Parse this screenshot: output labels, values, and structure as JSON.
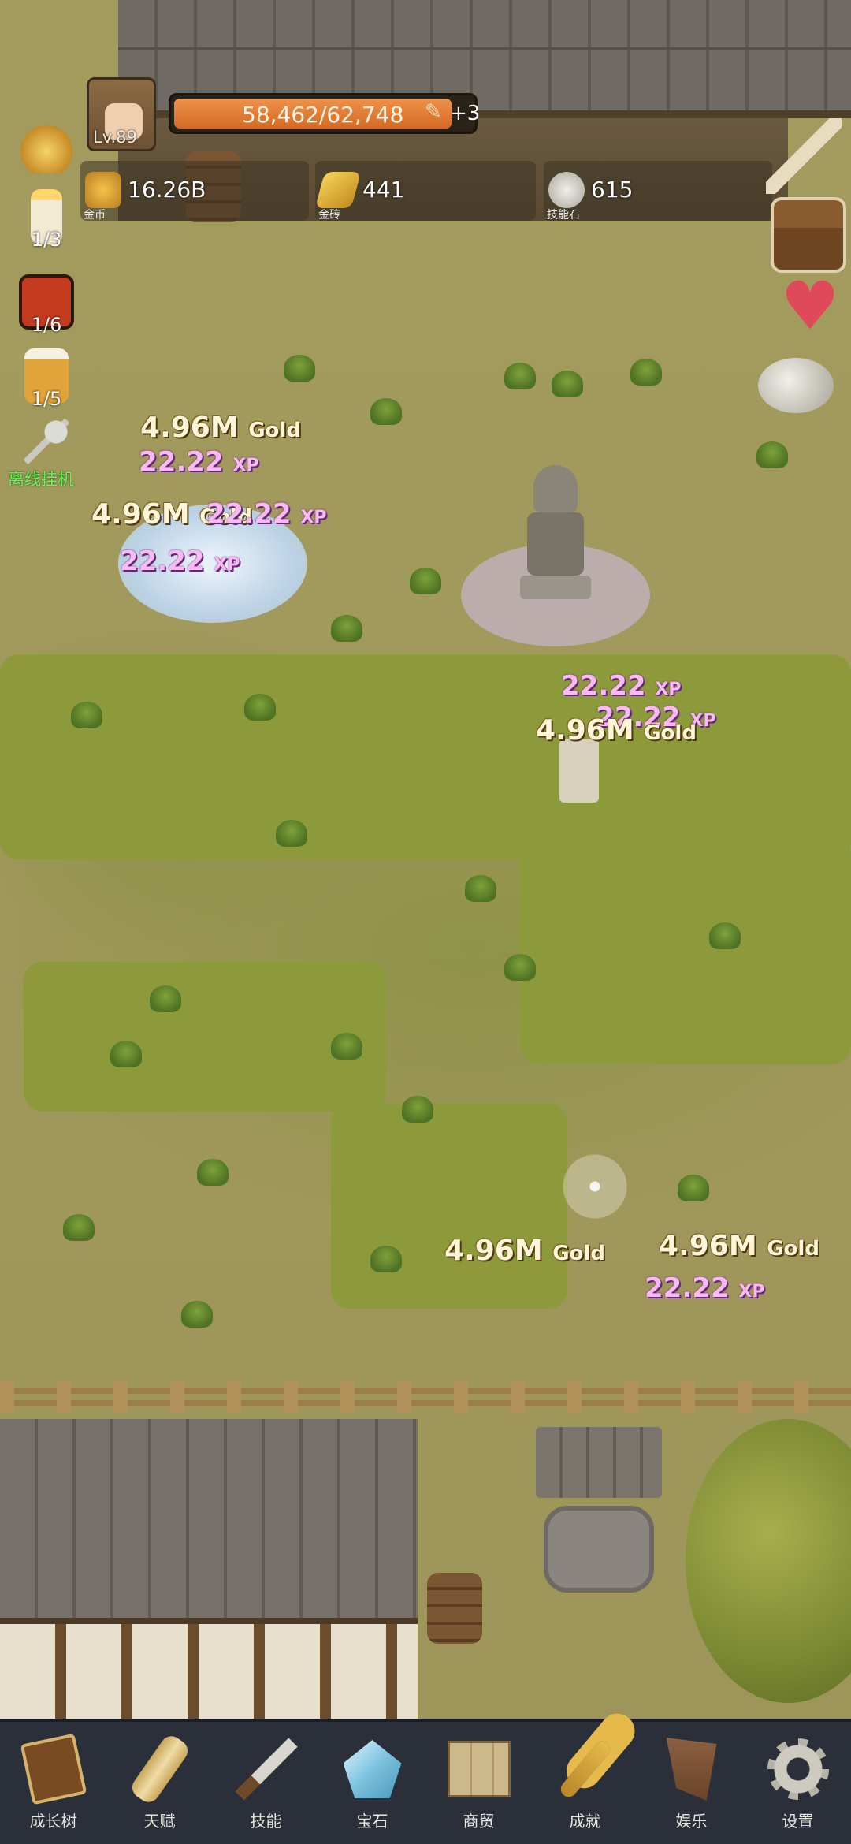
{
  "hud": {
    "level": "Lv.89",
    "xp_text": "58,462/62,748",
    "xp_fraction": 0.9317,
    "xp_bonus": "+3",
    "resources": [
      {
        "value": "16.26B",
        "label": "金币",
        "icon": "gold-coin-icon"
      },
      {
        "value": "441",
        "label": "金砖",
        "icon": "gold-bar-icon"
      },
      {
        "value": "615",
        "label": "技能石",
        "icon": "skill-stone-icon"
      }
    ]
  },
  "left_side": {
    "candle_count": "1/3",
    "dice_count": "1/6",
    "beer_count": "1/5",
    "afk_label": "离线挂机"
  },
  "floating": {
    "gold_value": "4.96M",
    "gold_unit": "Gold",
    "xp_value": "22.22",
    "xp_unit": "XP"
  },
  "bottom_nav": {
    "items": [
      {
        "label": "成长树",
        "icon": "book-icon"
      },
      {
        "label": "天赋",
        "icon": "scroll-icon"
      },
      {
        "label": "技能",
        "icon": "sword-icon"
      },
      {
        "label": "宝石",
        "icon": "crystal-icon"
      },
      {
        "label": "商贸",
        "icon": "map-icon"
      },
      {
        "label": "成就",
        "icon": "key-icon"
      },
      {
        "label": "娱乐",
        "icon": "flag-icon"
      },
      {
        "label": "设置",
        "icon": "gear-icon"
      }
    ]
  }
}
